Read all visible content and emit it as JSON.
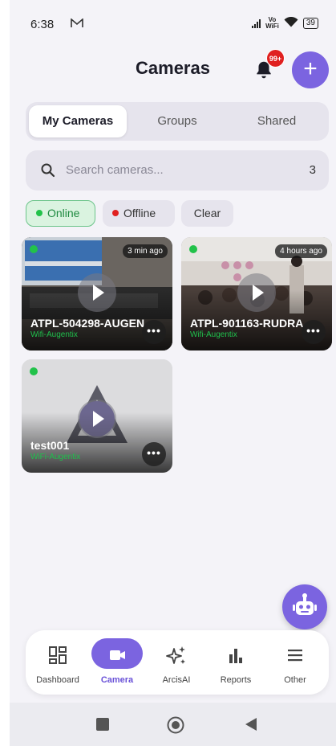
{
  "status_bar": {
    "time": "6:38",
    "battery": "39"
  },
  "header": {
    "title": "Cameras",
    "notification_badge": "99+",
    "add_label": "+"
  },
  "tabs": [
    {
      "label": "My Cameras",
      "active": true
    },
    {
      "label": "Groups",
      "active": false
    },
    {
      "label": "Shared",
      "active": false
    }
  ],
  "search": {
    "placeholder": "Search cameras...",
    "count": "3"
  },
  "filters": {
    "online": "Online",
    "offline": "Offline",
    "clear": "Clear"
  },
  "cameras": [
    {
      "name": "ATPL-504298-AUGEN",
      "network": "Wifi-Augentix",
      "ago": "3 min ago",
      "status": "online"
    },
    {
      "name": "ATPL-901163-RUDRA",
      "network": "Wifi-Augentix",
      "ago": "4 hours ago",
      "status": "online"
    },
    {
      "name": "test001",
      "network": "WiFi-Augentix",
      "ago": "",
      "status": "online"
    }
  ],
  "bottom_nav": [
    {
      "label": "Dashboard",
      "icon": "dashboard-icon"
    },
    {
      "label": "Camera",
      "icon": "camera-icon",
      "active": true
    },
    {
      "label": "ArcisAI",
      "icon": "sparkle-icon"
    },
    {
      "label": "Reports",
      "icon": "bar-chart-icon"
    },
    {
      "label": "Other",
      "icon": "menu-icon"
    }
  ],
  "colors": {
    "accent": "#7b64e0",
    "online": "#22c24a",
    "offline": "#e02020",
    "badge": "#e02020"
  }
}
